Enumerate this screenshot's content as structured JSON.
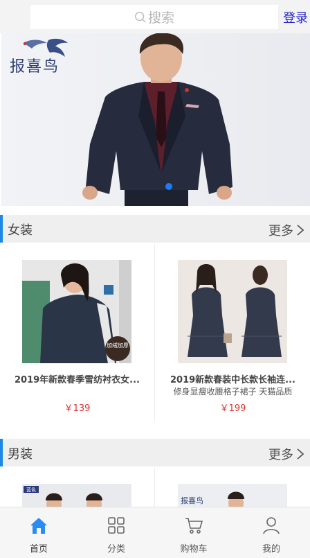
{
  "header": {
    "search_placeholder": "搜索",
    "login_label": "登录"
  },
  "banner": {
    "brand_text": "报喜鸟"
  },
  "sections": [
    {
      "title": "女装",
      "more": "更多",
      "products": [
        {
          "name": "2019年新款春季雪纺衬衣女...",
          "subtitle": "",
          "price": "￥139",
          "badge": "加绒加厚"
        },
        {
          "name": "2019新款春装中长款长袖连...",
          "subtitle": "修身显瘦收腰格子裙子 天猫品质",
          "price": "￥199"
        }
      ]
    },
    {
      "title": "男装",
      "more": "更多",
      "products": [
        {
          "badge": "蓝色"
        },
        {
          "brand": "报喜鸟"
        }
      ]
    }
  ],
  "tabbar": [
    {
      "label": "首页",
      "icon": "home-icon",
      "active": true
    },
    {
      "label": "分类",
      "icon": "category-icon"
    },
    {
      "label": "购物车",
      "icon": "cart-icon"
    },
    {
      "label": "我的",
      "icon": "user-icon"
    }
  ],
  "colors": {
    "accent": "#1e88e5",
    "price": "#e03030",
    "link": "#2222cc"
  }
}
